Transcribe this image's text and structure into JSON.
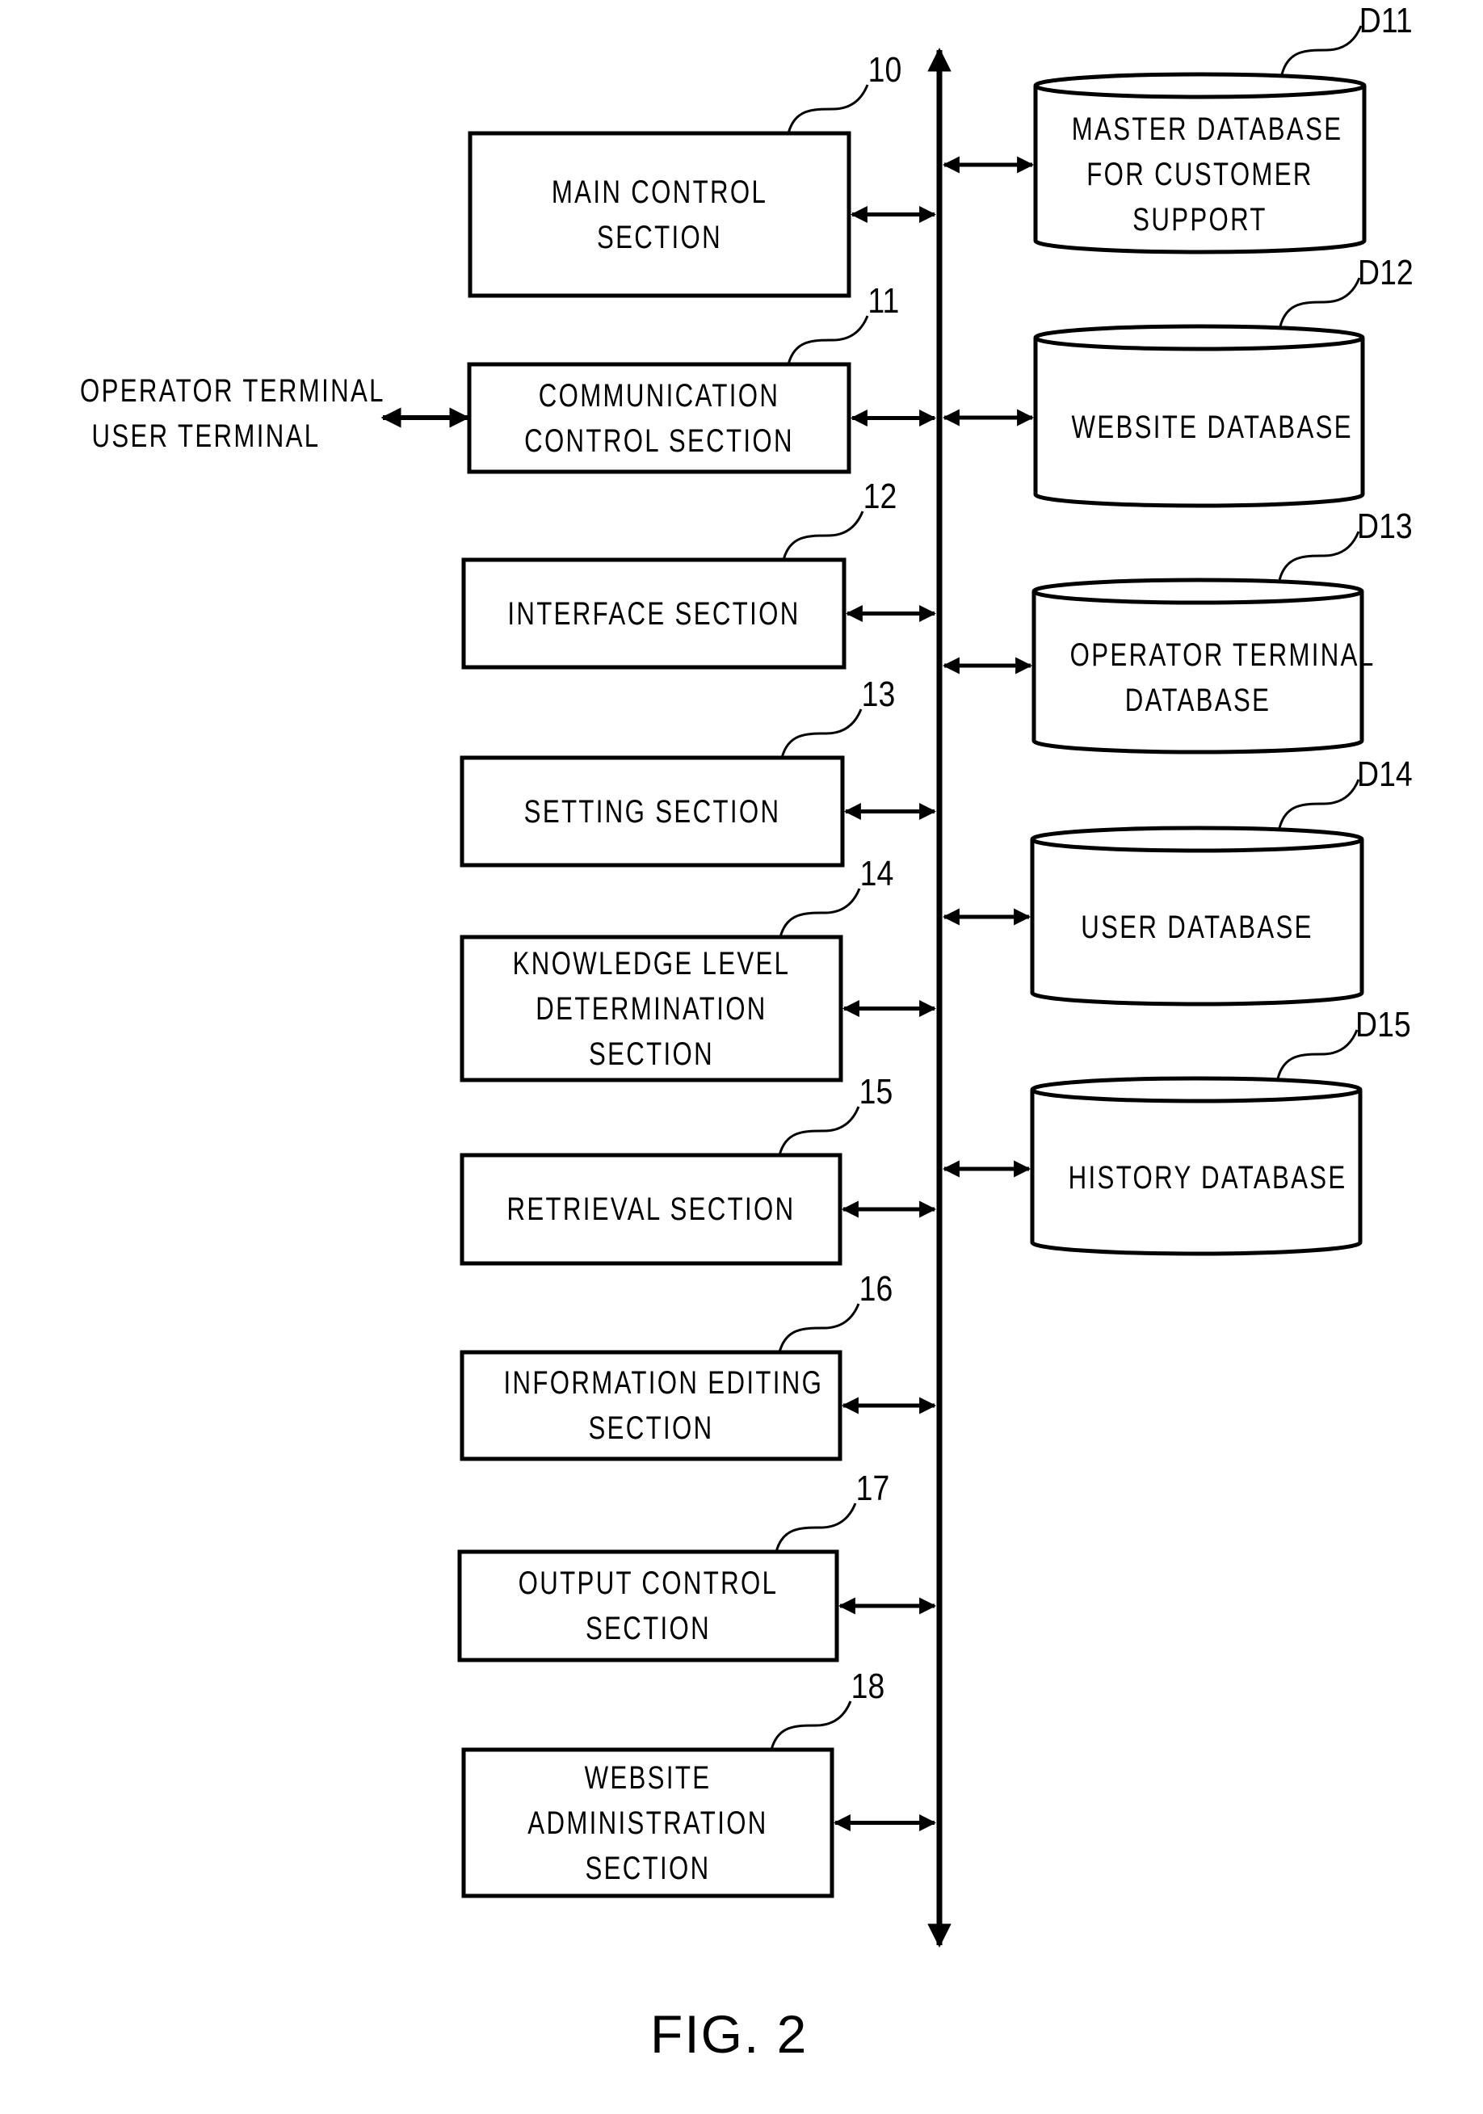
{
  "figure": {
    "caption": "FIG. 2",
    "bus": "bidirectional-bus",
    "external": {
      "lines": [
        "OPERATOR TERMINAL",
        "USER TERMINAL"
      ]
    },
    "sections": [
      {
        "ref": "10",
        "lines": [
          "MAIN CONTROL",
          "SECTION"
        ]
      },
      {
        "ref": "11",
        "lines": [
          "COMMUNICATION",
          "CONTROL SECTION"
        ]
      },
      {
        "ref": "12",
        "lines": [
          "INTERFACE SECTION"
        ]
      },
      {
        "ref": "13",
        "lines": [
          "SETTING SECTION"
        ]
      },
      {
        "ref": "14",
        "lines": [
          "KNOWLEDGE LEVEL",
          "DETERMINATION",
          "SECTION"
        ]
      },
      {
        "ref": "15",
        "lines": [
          "RETRIEVAL SECTION"
        ]
      },
      {
        "ref": "16",
        "lines": [
          "INFORMATION EDITING",
          "SECTION"
        ]
      },
      {
        "ref": "17",
        "lines": [
          "OUTPUT CONTROL",
          "SECTION"
        ]
      },
      {
        "ref": "18",
        "lines": [
          "WEBSITE",
          "ADMINISTRATION",
          "SECTION"
        ]
      }
    ],
    "databases": [
      {
        "ref": "D11",
        "lines": [
          "MASTER DATABASE",
          "FOR CUSTOMER",
          "SUPPORT"
        ]
      },
      {
        "ref": "D12",
        "lines": [
          "WEBSITE DATABASE"
        ]
      },
      {
        "ref": "D13",
        "lines": [
          "OPERATOR TERMINAL",
          "DATABASE"
        ]
      },
      {
        "ref": "D14",
        "lines": [
          "USER DATABASE"
        ]
      },
      {
        "ref": "D15",
        "lines": [
          "HISTORY DATABASE"
        ]
      }
    ]
  }
}
